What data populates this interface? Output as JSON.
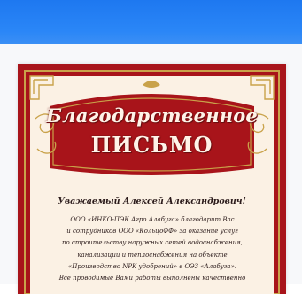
{
  "letter": {
    "title_line1": "Благодарственное",
    "title_line2": "ПИСЬМО",
    "greeting": "Уважаемый Алексей Александрович!",
    "body_lines": [
      "ООО «ИНКО-ПЭК Агро Алабуга» благодарит Вас",
      "и сотрудников ООО «КольцоФФ» за оказание услуг",
      "по строительству наружных сетей водоснабжения,",
      "канализации и теплоснабжения на объекте",
      "«Производство NPK удобрений» в ОЭЗ «Алабуга».",
      "Все проводимые Вами работы выполнены качественно"
    ]
  },
  "colors": {
    "band": "#2a86f7",
    "frame_red": "#a8141a",
    "frame_gold": "#c9a24a",
    "inner_cream": "#fbf1e4"
  }
}
